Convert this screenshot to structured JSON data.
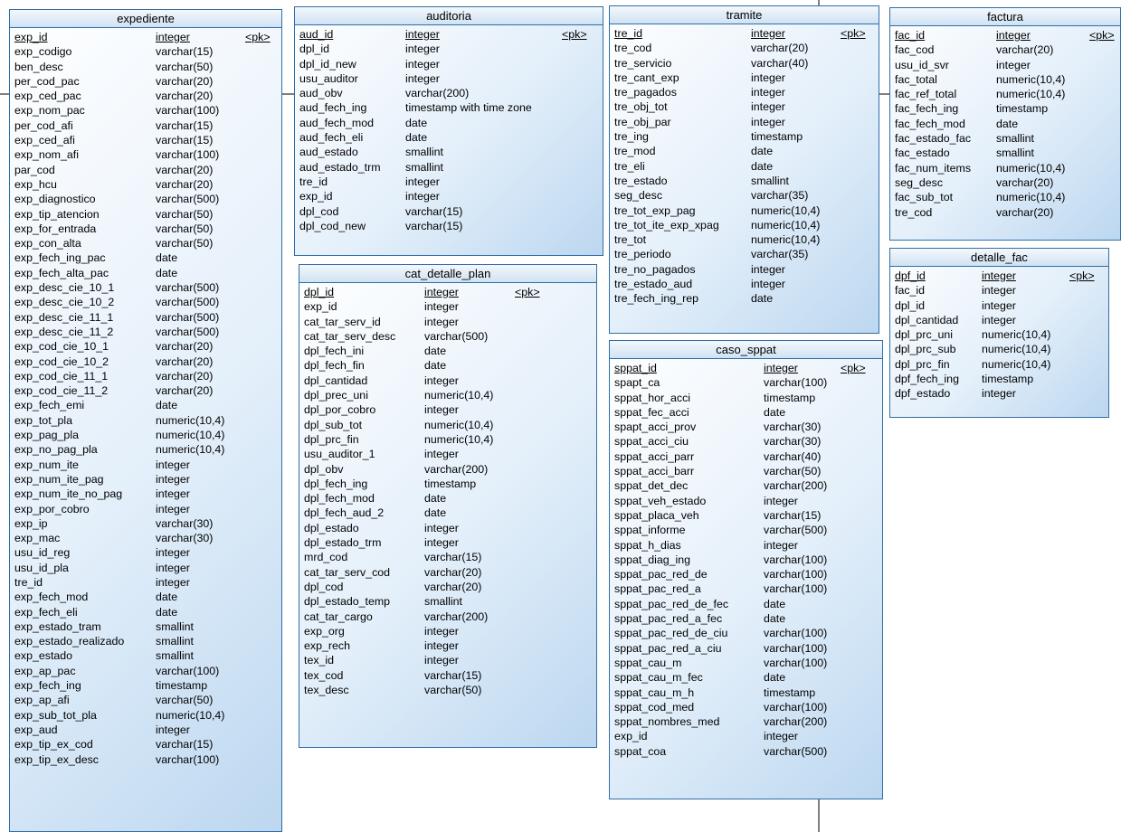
{
  "tables": [
    {
      "id": "expediente",
      "title": "expediente",
      "columns": [
        {
          "name": "exp_id",
          "type": "integer",
          "key": "<pk>"
        },
        {
          "name": "exp_codigo",
          "type": "varchar(15)"
        },
        {
          "name": "ben_desc",
          "type": "varchar(50)"
        },
        {
          "name": "per_cod_pac",
          "type": "varchar(20)"
        },
        {
          "name": "exp_ced_pac",
          "type": "varchar(20)"
        },
        {
          "name": "exp_nom_pac",
          "type": "varchar(100)"
        },
        {
          "name": "per_cod_afi",
          "type": "varchar(15)"
        },
        {
          "name": "exp_ced_afi",
          "type": "varchar(15)"
        },
        {
          "name": "exp_nom_afi",
          "type": "varchar(100)"
        },
        {
          "name": "par_cod",
          "type": "varchar(20)"
        },
        {
          "name": "exp_hcu",
          "type": "varchar(20)"
        },
        {
          "name": "exp_diagnostico",
          "type": "varchar(500)"
        },
        {
          "name": "exp_tip_atencion",
          "type": "varchar(50)"
        },
        {
          "name": "exp_for_entrada",
          "type": "varchar(50)"
        },
        {
          "name": "exp_con_alta",
          "type": "varchar(50)"
        },
        {
          "name": "exp_fech_ing_pac",
          "type": "date"
        },
        {
          "name": "exp_fech_alta_pac",
          "type": "date"
        },
        {
          "name": "exp_desc_cie_10_1",
          "type": "varchar(500)"
        },
        {
          "name": "exp_desc_cie_10_2",
          "type": "varchar(500)"
        },
        {
          "name": "exp_desc_cie_11_1",
          "type": "varchar(500)"
        },
        {
          "name": "exp_desc_cie_11_2",
          "type": "varchar(500)"
        },
        {
          "name": "exp_cod_cie_10_1",
          "type": "varchar(20)"
        },
        {
          "name": "exp_cod_cie_10_2",
          "type": "varchar(20)"
        },
        {
          "name": "exp_cod_cie_11_1",
          "type": "varchar(20)"
        },
        {
          "name": "exp_cod_cie_11_2",
          "type": "varchar(20)"
        },
        {
          "name": "exp_fech_emi",
          "type": "date"
        },
        {
          "name": "exp_tot_pla",
          "type": "numeric(10,4)"
        },
        {
          "name": "exp_pag_pla",
          "type": "numeric(10,4)"
        },
        {
          "name": "exp_no_pag_pla",
          "type": "numeric(10,4)"
        },
        {
          "name": "exp_num_ite",
          "type": "integer"
        },
        {
          "name": "exp_num_ite_pag",
          "type": "integer"
        },
        {
          "name": "exp_num_ite_no_pag",
          "type": "integer"
        },
        {
          "name": "exp_por_cobro",
          "type": "integer"
        },
        {
          "name": "exp_ip",
          "type": "varchar(30)"
        },
        {
          "name": "exp_mac",
          "type": "varchar(30)"
        },
        {
          "name": "usu_id_reg",
          "type": "integer"
        },
        {
          "name": "usu_id_pla",
          "type": "integer"
        },
        {
          "name": "tre_id",
          "type": "integer"
        },
        {
          "name": "exp_fech_mod",
          "type": "date"
        },
        {
          "name": "exp_fech_eli",
          "type": "date"
        },
        {
          "name": "exp_estado_tram",
          "type": "smallint"
        },
        {
          "name": "exp_estado_realizado",
          "type": "smallint"
        },
        {
          "name": "exp_estado",
          "type": "smallint"
        },
        {
          "name": "exp_ap_pac",
          "type": "varchar(100)"
        },
        {
          "name": "exp_fech_ing",
          "type": "timestamp"
        },
        {
          "name": "exp_ap_afi",
          "type": "varchar(50)"
        },
        {
          "name": "exp_sub_tot_pla",
          "type": "numeric(10,4)"
        },
        {
          "name": "exp_aud",
          "type": "integer"
        },
        {
          "name": "exp_tip_ex_cod",
          "type": "varchar(15)"
        },
        {
          "name": "exp_tip_ex_desc",
          "type": "varchar(100)"
        }
      ]
    },
    {
      "id": "auditoria",
      "title": "auditoria",
      "columns": [
        {
          "name": "aud_id",
          "type": "integer",
          "key": "<pk>"
        },
        {
          "name": "dpl_id",
          "type": "integer"
        },
        {
          "name": "dpl_id_new",
          "type": "integer"
        },
        {
          "name": "usu_auditor",
          "type": "integer"
        },
        {
          "name": "aud_obv",
          "type": "varchar(200)"
        },
        {
          "name": "aud_fech_ing",
          "type": "timestamp with time zone"
        },
        {
          "name": "aud_fech_mod",
          "type": "date"
        },
        {
          "name": "aud_fech_eli",
          "type": "date"
        },
        {
          "name": "aud_estado",
          "type": "smallint"
        },
        {
          "name": "aud_estado_trm",
          "type": "smallint"
        },
        {
          "name": "tre_id",
          "type": "integer"
        },
        {
          "name": "exp_id",
          "type": "integer"
        },
        {
          "name": "dpl_cod",
          "type": "varchar(15)"
        },
        {
          "name": "dpl_cod_new",
          "type": "varchar(15)"
        }
      ]
    },
    {
      "id": "cat_detalle_plan",
      "title": "cat_detalle_plan",
      "columns": [
        {
          "name": "dpl_id",
          "type": "integer",
          "key": "<pk>"
        },
        {
          "name": "exp_id",
          "type": "integer"
        },
        {
          "name": "cat_tar_serv_id",
          "type": "integer"
        },
        {
          "name": "cat_tar_serv_desc",
          "type": "varchar(500)"
        },
        {
          "name": "dpl_fech_ini",
          "type": "date"
        },
        {
          "name": "dpl_fech_fin",
          "type": "date"
        },
        {
          "name": "dpl_cantidad",
          "type": "integer"
        },
        {
          "name": "dpl_prec_uni",
          "type": "numeric(10,4)"
        },
        {
          "name": "dpl_por_cobro",
          "type": "integer"
        },
        {
          "name": "dpl_sub_tot",
          "type": "numeric(10,4)"
        },
        {
          "name": "dpl_prc_fin",
          "type": "numeric(10,4)"
        },
        {
          "name": "usu_auditor_1",
          "type": "integer"
        },
        {
          "name": "dpl_obv",
          "type": "varchar(200)"
        },
        {
          "name": "dpl_fech_ing",
          "type": "timestamp"
        },
        {
          "name": "dpl_fech_mod",
          "type": "date"
        },
        {
          "name": "dpl_fech_aud_2",
          "type": "date"
        },
        {
          "name": "dpl_estado",
          "type": "integer"
        },
        {
          "name": "dpl_estado_trm",
          "type": "integer"
        },
        {
          "name": "mrd_cod",
          "type": "varchar(15)"
        },
        {
          "name": "cat_tar_serv_cod",
          "type": "varchar(20)"
        },
        {
          "name": "dpl_cod",
          "type": "varchar(20)"
        },
        {
          "name": "dpl_estado_temp",
          "type": "smallint"
        },
        {
          "name": "cat_tar_cargo",
          "type": "varchar(200)"
        },
        {
          "name": "exp_org",
          "type": "integer"
        },
        {
          "name": "exp_rech",
          "type": "integer"
        },
        {
          "name": "tex_id",
          "type": "integer"
        },
        {
          "name": "tex_cod",
          "type": "varchar(15)"
        },
        {
          "name": "tex_desc",
          "type": "varchar(50)"
        }
      ]
    },
    {
      "id": "tramite",
      "title": "tramite",
      "columns": [
        {
          "name": "tre_id",
          "type": "integer",
          "key": "<pk>"
        },
        {
          "name": "tre_cod",
          "type": "varchar(20)"
        },
        {
          "name": "tre_servicio",
          "type": "varchar(40)"
        },
        {
          "name": "tre_cant_exp",
          "type": "integer"
        },
        {
          "name": "tre_pagados",
          "type": "integer"
        },
        {
          "name": "tre_obj_tot",
          "type": "integer"
        },
        {
          "name": "tre_obj_par",
          "type": "integer"
        },
        {
          "name": "tre_ing",
          "type": "timestamp"
        },
        {
          "name": "tre_mod",
          "type": "date"
        },
        {
          "name": "tre_eli",
          "type": "date"
        },
        {
          "name": "tre_estado",
          "type": "smallint"
        },
        {
          "name": "seg_desc",
          "type": "varchar(35)"
        },
        {
          "name": "tre_tot_exp_pag",
          "type": "numeric(10,4)"
        },
        {
          "name": "tre_tot_ite_exp_xpag",
          "type": "numeric(10,4)"
        },
        {
          "name": "tre_tot",
          "type": "numeric(10,4)"
        },
        {
          "name": "tre_periodo",
          "type": "varchar(35)"
        },
        {
          "name": "tre_no_pagados",
          "type": "integer"
        },
        {
          "name": "tre_estado_aud",
          "type": "integer"
        },
        {
          "name": "tre_fech_ing_rep",
          "type": "date"
        }
      ]
    },
    {
      "id": "caso_sppat",
      "title": "caso_sppat",
      "columns": [
        {
          "name": "sppat_id",
          "type": "integer",
          "key": "<pk>"
        },
        {
          "name": "spapt_ca",
          "type": "varchar(100)"
        },
        {
          "name": "sppat_hor_acci",
          "type": "timestamp"
        },
        {
          "name": "sppat_fec_acci",
          "type": "date"
        },
        {
          "name": "spapt_acci_prov",
          "type": "varchar(30)"
        },
        {
          "name": "sppat_acci_ciu",
          "type": "varchar(30)"
        },
        {
          "name": "sppat_acci_parr",
          "type": "varchar(40)"
        },
        {
          "name": "sppat_acci_barr",
          "type": "varchar(50)"
        },
        {
          "name": "sppat_det_dec",
          "type": "varchar(200)"
        },
        {
          "name": "sppat_veh_estado",
          "type": "integer"
        },
        {
          "name": "sppat_placa_veh",
          "type": "varchar(15)"
        },
        {
          "name": "sppat_informe",
          "type": "varchar(500)"
        },
        {
          "name": "sppat_h_dias",
          "type": "integer"
        },
        {
          "name": "sppat_diag_ing",
          "type": "varchar(100)"
        },
        {
          "name": "sppat_pac_red_de",
          "type": "varchar(100)"
        },
        {
          "name": "sppat_pac_red_a",
          "type": "varchar(100)"
        },
        {
          "name": "sppat_pac_red_de_fec",
          "type": "date"
        },
        {
          "name": "sppat_pac_red_a_fec",
          "type": "date"
        },
        {
          "name": "sppat_pac_red_de_ciu",
          "type": "varchar(100)"
        },
        {
          "name": "sppat_pac_red_a_ciu",
          "type": "varchar(100)"
        },
        {
          "name": "sppat_cau_m",
          "type": "varchar(100)"
        },
        {
          "name": "sppat_cau_m_fec",
          "type": "date"
        },
        {
          "name": "sppat_cau_m_h",
          "type": "timestamp"
        },
        {
          "name": "sppat_cod_med",
          "type": "varchar(100)"
        },
        {
          "name": "sppat_nombres_med",
          "type": "varchar(200)"
        },
        {
          "name": "exp_id",
          "type": "integer"
        },
        {
          "name": "sppat_coa",
          "type": "varchar(500)"
        }
      ]
    },
    {
      "id": "factura",
      "title": "factura",
      "columns": [
        {
          "name": "fac_id",
          "type": "integer",
          "key": "<pk>"
        },
        {
          "name": "fac_cod",
          "type": "varchar(20)"
        },
        {
          "name": "usu_id_svr",
          "type": "integer"
        },
        {
          "name": "fac_total",
          "type": "numeric(10,4)"
        },
        {
          "name": "fac_ref_total",
          "type": "numeric(10,4)"
        },
        {
          "name": "fac_fech_ing",
          "type": "timestamp"
        },
        {
          "name": "fac_fech_mod",
          "type": "date"
        },
        {
          "name": "fac_estado_fac",
          "type": "smallint"
        },
        {
          "name": "fac_estado",
          "type": "smallint"
        },
        {
          "name": "fac_num_items",
          "type": "numeric(10,4)"
        },
        {
          "name": "seg_desc",
          "type": "varchar(20)"
        },
        {
          "name": "fac_sub_tot",
          "type": "numeric(10,4)"
        },
        {
          "name": "tre_cod",
          "type": "varchar(20)"
        }
      ]
    },
    {
      "id": "detalle_fac",
      "title": "detalle_fac",
      "columns": [
        {
          "name": "dpf_id",
          "type": "integer",
          "key": "<pk>"
        },
        {
          "name": "fac_id",
          "type": "integer"
        },
        {
          "name": "dpl_id",
          "type": "integer"
        },
        {
          "name": "dpl_cantidad",
          "type": "integer"
        },
        {
          "name": "dpl_prc_uni",
          "type": "numeric(10,4)"
        },
        {
          "name": "dpl_prc_sub",
          "type": "numeric(10,4)"
        },
        {
          "name": "dpl_prc_fin",
          "type": "numeric(10,4)"
        },
        {
          "name": "dpf_fech_ing",
          "type": "timestamp"
        },
        {
          "name": "dpf_estado",
          "type": "integer"
        }
      ]
    }
  ],
  "colors": {
    "border": "#2f6fa7",
    "fill_light": "#ffffff",
    "fill_dark": "#bcd7f0",
    "connector": "#000000"
  }
}
